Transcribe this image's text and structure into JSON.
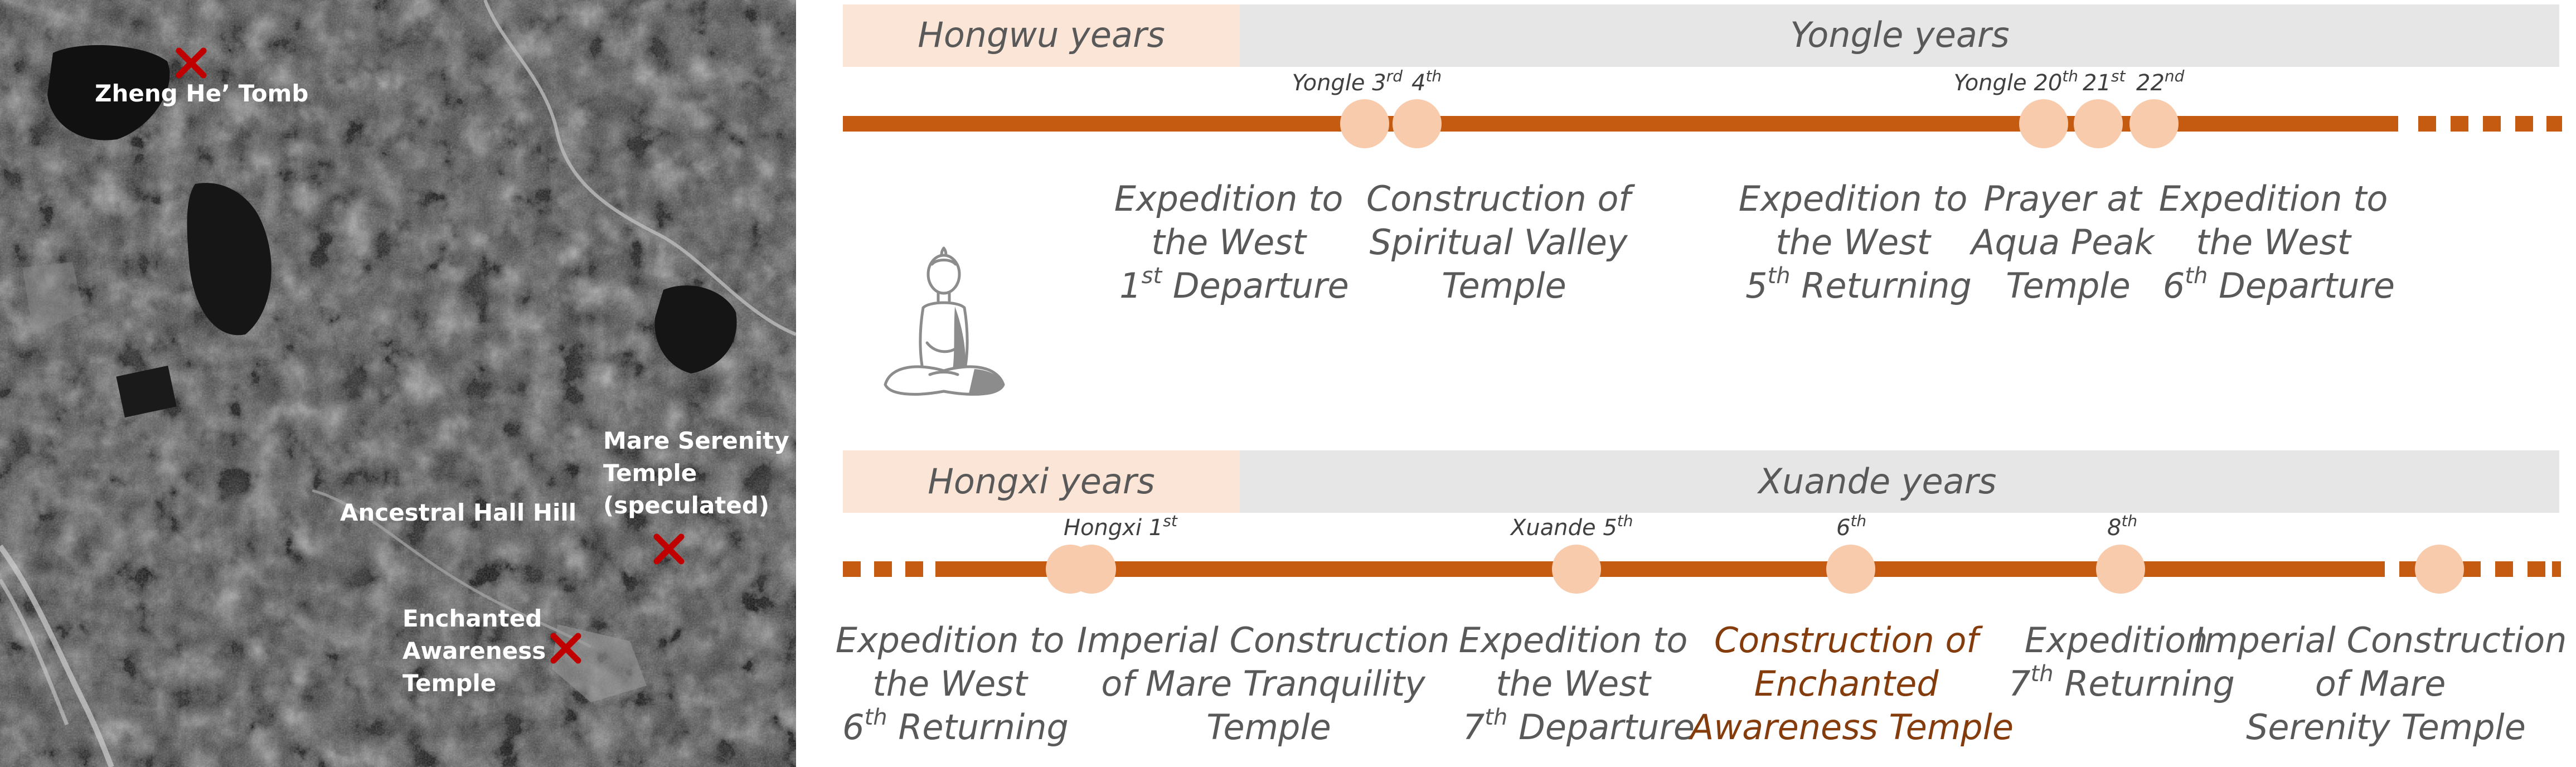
{
  "map": {
    "locations": [
      {
        "label_lines": [
          "Zheng He’ Tomb"
        ]
      },
      {
        "label_lines": [
          "Ancestral Hall Hill"
        ]
      },
      {
        "label_lines": [
          "Mare Serenity",
          "Temple",
          "(speculated)"
        ]
      },
      {
        "label_lines": [
          "Enchanted",
          "Awareness",
          "Temple"
        ]
      }
    ]
  },
  "timeline": {
    "colors": {
      "line": "#c55a11",
      "dot": "#f8cbad",
      "first_period_band": "#fbe5d6",
      "second_period_band": "#e7e6e6",
      "highlight_text": "#843c0c"
    },
    "icon": "seated-buddha-icon",
    "rows": [
      {
        "periods": [
          "Hongwu years",
          "Yongle years"
        ],
        "ticks": [
          {
            "main": "Yongle 3",
            "sup": "rd"
          },
          {
            "main": "4",
            "sup": "th"
          },
          {
            "main": "Yongle 20",
            "sup": "th"
          },
          {
            "main": "21",
            "sup": "st"
          },
          {
            "main": "22",
            "sup": "nd"
          }
        ],
        "events": [
          {
            "lines": [
              {
                "t": "Expedition to"
              },
              {
                "t": "the West"
              },
              {
                "t": "1",
                "sup": "st",
                "after": " Departure"
              }
            ]
          },
          {
            "lines": [
              {
                "t": "Construction of"
              },
              {
                "t": "Spiritual Valley"
              },
              {
                "t": "Temple"
              }
            ]
          },
          {
            "lines": [
              {
                "t": "Expedition to"
              },
              {
                "t": "the West"
              },
              {
                "t": "5",
                "sup": "th",
                "after": " Returning"
              }
            ]
          },
          {
            "lines": [
              {
                "t": "Prayer at"
              },
              {
                "t": "Aqua Peak"
              },
              {
                "t": "Temple"
              }
            ]
          },
          {
            "lines": [
              {
                "t": "Expedition to"
              },
              {
                "t": "the West"
              },
              {
                "t": "6",
                "sup": "th",
                "after": " Departure"
              }
            ]
          }
        ]
      },
      {
        "periods": [
          "Hongxi years",
          "Xuande years"
        ],
        "ticks": [
          {
            "main": "Hongxi 1",
            "sup": "st"
          },
          {
            "main": "Xuande 5",
            "sup": "th"
          },
          {
            "main": "6",
            "sup": "th"
          },
          {
            "main": "8",
            "sup": "th"
          }
        ],
        "events": [
          {
            "lines": [
              {
                "t": "Expedition to"
              },
              {
                "t": "the West"
              },
              {
                "t": "6",
                "sup": "th",
                "after": " Returning"
              }
            ]
          },
          {
            "lines": [
              {
                "t": "Imperial Construction"
              },
              {
                "t": "of Mare Tranquility"
              },
              {
                "t": "Temple"
              }
            ]
          },
          {
            "lines": [
              {
                "t": "Expedition to"
              },
              {
                "t": "the West"
              },
              {
                "t": "7",
                "sup": "th",
                "after": " Departure"
              }
            ]
          },
          {
            "highlight": true,
            "lines": [
              {
                "t": "Construction of"
              },
              {
                "t": "Enchanted"
              },
              {
                "t": "Awareness Temple"
              }
            ]
          },
          {
            "lines": [
              {
                "t": "Expedition"
              },
              {
                "t": "7",
                "sup": "th",
                "after": " Returning"
              }
            ]
          },
          {
            "lines": [
              {
                "t": "Imperial Construction"
              },
              {
                "t": "of Mare"
              },
              {
                "t": "Serenity Temple"
              }
            ]
          }
        ]
      }
    ]
  }
}
